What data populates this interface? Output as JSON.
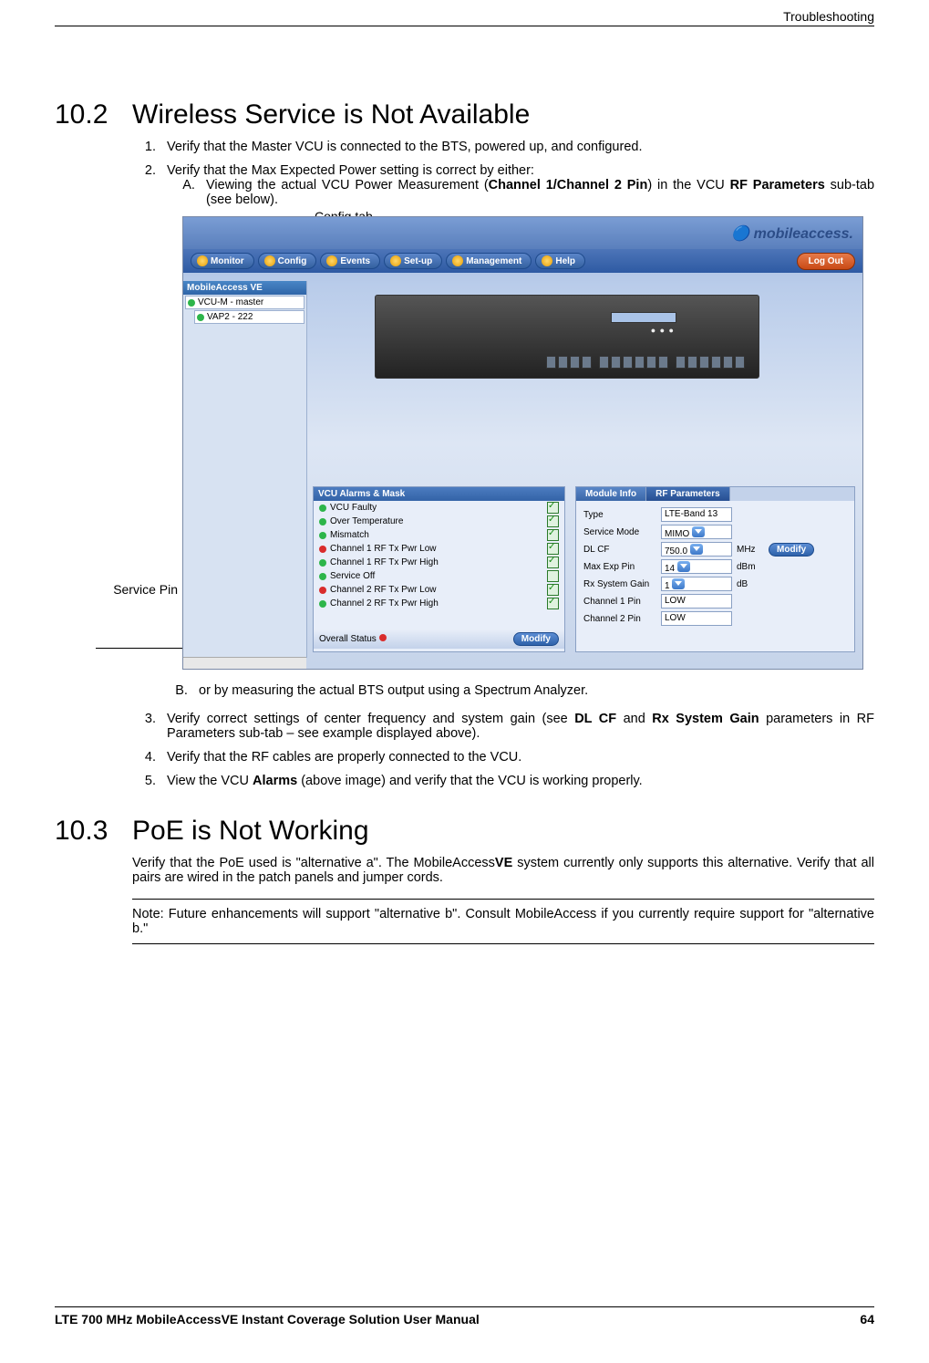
{
  "header": {
    "running": "Troubleshooting"
  },
  "footer": {
    "title": "LTE 700 MHz MobileAccessVE Instant Coverage Solution User Manual",
    "page": "64"
  },
  "sec102": {
    "num": "10.2",
    "title": "Wireless Service is Not Available",
    "item1": "Verify that the Master VCU is connected to the BTS, powered up, and configured.",
    "item2": "Verify that the Max Expected Power setting is correct by either:",
    "subA_pre": "Viewing the actual VCU Power Measurement (",
    "subA_bold1": "Channel 1/Channel 2 Pin",
    "subA_mid": ") in the VCU ",
    "subA_bold2": "RF Parameters",
    "subA_post": " sub-tab (see below).",
    "subB": "or by measuring the actual BTS output using a Spectrum Analyzer.",
    "item3_pre": "Verify correct settings of center frequency and system gain (see ",
    "item3_b1": "DL CF",
    "item3_mid": " and ",
    "item3_b2": "Rx  System Gain",
    "item3_post": " parameters in RF Parameters sub-tab – see example displayed above).",
    "item4": "Verify that the RF cables are properly connected to the VCU.",
    "item5_pre": "View the VCU ",
    "item5_b": "Alarms",
    "item5_post": " (above image) and verify that the VCU is working properly."
  },
  "sec103": {
    "num": "10.3",
    "title": "PoE is Not Working",
    "p_pre": "Verify that the PoE used is \"alternative a\". The MobileAccess",
    "p_b": "VE",
    "p_post": " system currently only supports this alternative. Verify that all pairs are wired in the patch panels and jumper cords.",
    "note": "Note: Future enhancements will support \"alternative b\". Consult MobileAccess if you currently require support for \"alternative b.\""
  },
  "figure": {
    "config_tab_label": "Config tab",
    "service_pin_label": "Service Pin",
    "logo": "mobileaccess.",
    "nav": [
      "Monitor",
      "Config",
      "Events",
      "Set-up",
      "Management",
      "Help"
    ],
    "logout": "Log Out",
    "tree_hdr": "MobileAccess VE",
    "tree_items": [
      "VCU-M - master",
      "VAP2 - 222"
    ],
    "device_leds": "● ● ●",
    "alarms_hdr": "VCU Alarms & Mask",
    "alarms": [
      {
        "dot": "g",
        "label": "VCU Faulty",
        "chk": true
      },
      {
        "dot": "g",
        "label": "Over Temperature",
        "chk": true
      },
      {
        "dot": "g",
        "label": "Mismatch",
        "chk": true
      },
      {
        "dot": "r",
        "label": "Channel 1 RF Tx Pwr Low",
        "chk": true
      },
      {
        "dot": "g",
        "label": "Channel 1 RF Tx Pwr High",
        "chk": true
      },
      {
        "dot": "g",
        "label": "Service Off",
        "chk": false
      },
      {
        "dot": "r",
        "label": "Channel 2 RF Tx Pwr Low",
        "chk": true
      },
      {
        "dot": "g",
        "label": "Channel 2 RF Tx Pwr High",
        "chk": true
      }
    ],
    "overall_label": "Overall Status",
    "modify": "Modify",
    "tabs": [
      "Module Info",
      "RF Parameters"
    ],
    "rf_rows": [
      {
        "label": "Type",
        "value": "LTE-Band 13",
        "unit": "",
        "drop": false,
        "mod": false
      },
      {
        "label": "Service Mode",
        "value": "MIMO",
        "unit": "",
        "drop": true,
        "mod": false
      },
      {
        "label": "DL CF",
        "value": "750.0",
        "unit": "MHz",
        "drop": true,
        "mod": true
      },
      {
        "label": "Max Exp Pin",
        "value": "14",
        "unit": "dBm",
        "drop": true,
        "mod": false
      },
      {
        "label": "Rx System Gain",
        "value": "1",
        "unit": "dB",
        "drop": true,
        "mod": false
      },
      {
        "label": "Channel 1 Pin",
        "value": "LOW",
        "unit": "",
        "drop": false,
        "mod": false
      },
      {
        "label": "Channel 2 Pin",
        "value": "LOW",
        "unit": "",
        "drop": false,
        "mod": false
      }
    ]
  }
}
